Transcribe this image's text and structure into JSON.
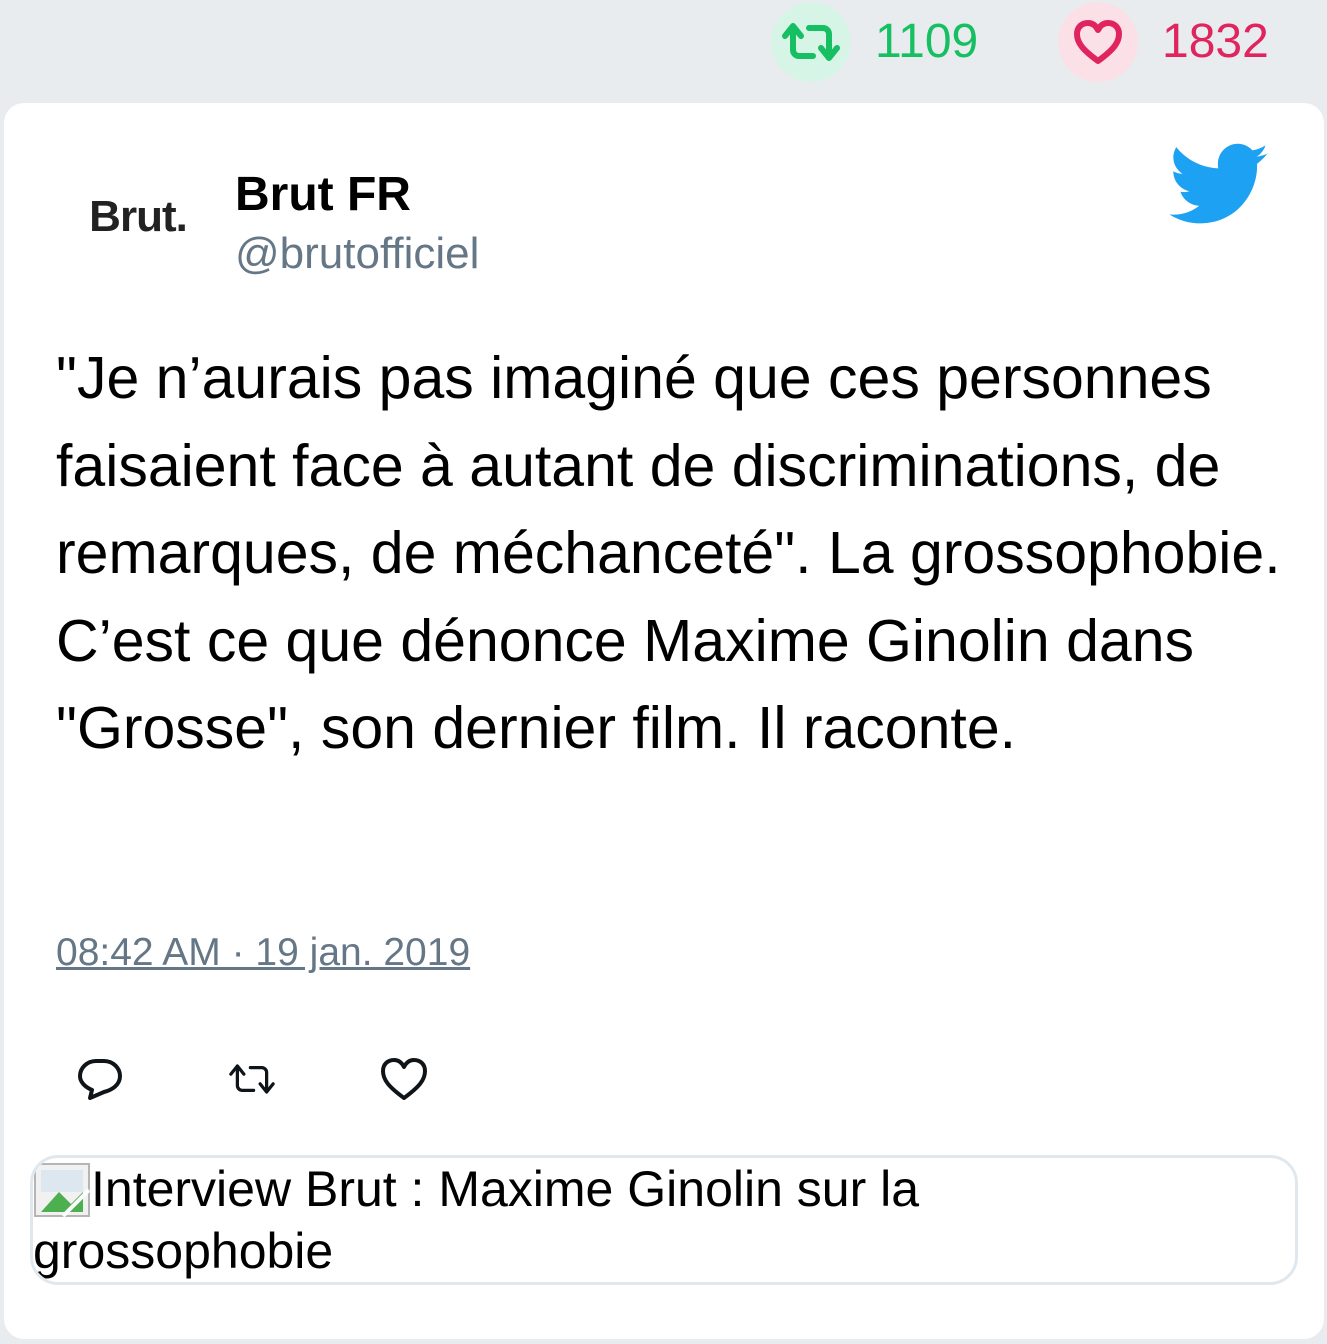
{
  "stats": {
    "retweet_count": "1109",
    "like_count": "1832",
    "retweet_color": "#17bf63",
    "like_color": "#e0245e"
  },
  "tweet": {
    "avatar_text": "Brut.",
    "author_name": "Brut FR",
    "author_handle": "@brutofficiel",
    "text": "\"Je n’aurais pas imaginé que ces personnes faisaient face à autant de discriminations, de remarques, de méchanceté\". La grossophobie. C’est ce que dénonce Maxime Ginolin dans \"Grosse\", son dernier film. Il raconte.",
    "timestamp": "08:42 AM · 19 jan. 2019",
    "brand_icon": "twitter-bird-icon",
    "brand_color": "#1da1f2"
  },
  "actions": {
    "reply_icon": "reply-icon",
    "retweet_icon": "retweet-icon",
    "like_icon": "heart-icon"
  },
  "media": {
    "alt_text": "Interview Brut : Maxime Ginolin sur la grossophobie",
    "icon": "broken-image-icon"
  }
}
